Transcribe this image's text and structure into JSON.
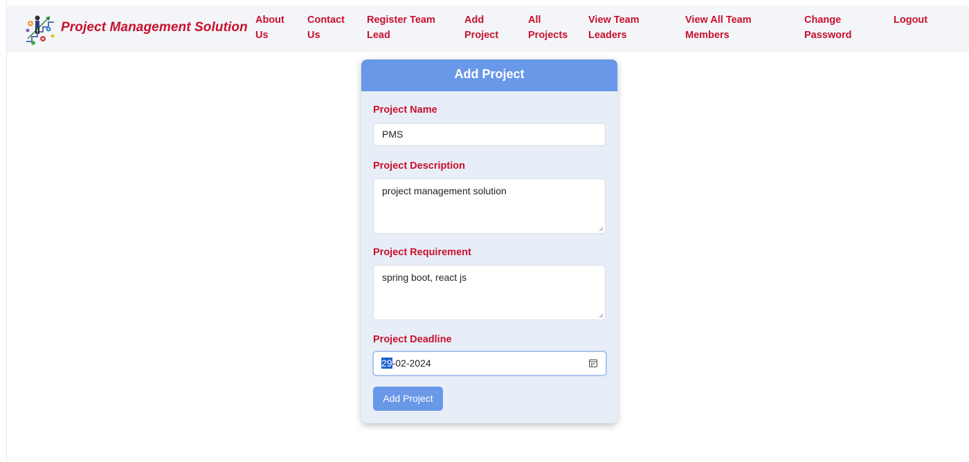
{
  "brand": {
    "title": "Project Management Solution",
    "logo_icon": "project-management-logo-icon"
  },
  "nav": {
    "items": [
      {
        "line1": "About",
        "line2": "Us"
      },
      {
        "line1": "Contact",
        "line2": "Us"
      },
      {
        "line1": "Register Team",
        "line2": "Lead"
      },
      {
        "line1": "Add",
        "line2": "Project"
      },
      {
        "line1": "All",
        "line2": "Projects"
      },
      {
        "line1": "View Team",
        "line2": "Leaders"
      },
      {
        "line1": "View All Team",
        "line2": "Members"
      },
      {
        "line1": "Change",
        "line2": "Password"
      },
      {
        "line1": "Logout",
        "line2": ""
      }
    ]
  },
  "form": {
    "header": "Add Project",
    "project_name": {
      "label": "Project Name",
      "value": "PMS"
    },
    "project_description": {
      "label": "Project Description",
      "value": "project management solution"
    },
    "project_requirement": {
      "label": "Project Requirement",
      "value": "spring boot, react js"
    },
    "project_deadline": {
      "label": "Project Deadline",
      "day": "29",
      "rest": "-02-2024",
      "icon": "calendar-icon"
    },
    "submit_label": "Add Project"
  },
  "colors": {
    "accent_red": "#c8102e",
    "header_blue": "#6a98e8",
    "navbar_bg": "#f3f5f8",
    "card_bg": "#e8eef7"
  }
}
